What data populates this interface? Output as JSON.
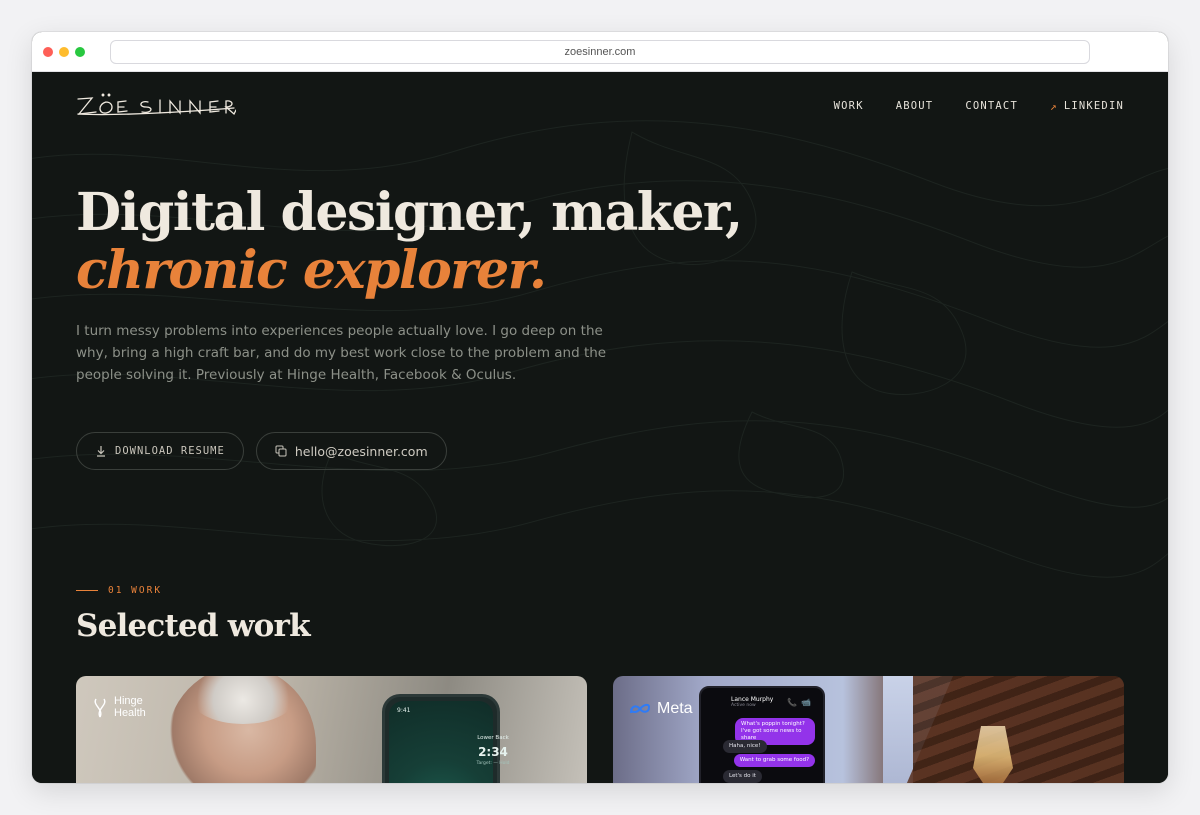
{
  "browser": {
    "url": "zoesinner.com"
  },
  "nav": {
    "logo_text": "ZOË SINNER",
    "links": [
      {
        "label": "WORK"
      },
      {
        "label": "ABOUT"
      },
      {
        "label": "CONTACT"
      },
      {
        "label": "LINKEDIN",
        "icon": "arrow-up-right-icon"
      }
    ]
  },
  "hero": {
    "title_line1": "Digital designer, maker,",
    "title_line2": "chronic explorer.",
    "copy": "I turn messy problems into experiences people actually love. I go deep on the why, bring a high craft bar, and do my best work close to the problem and the people solving it. Previously at Hinge Health, Facebook & Oculus.",
    "resume_label": "DOWNLOAD RESUME",
    "email_label": "hello@zoesinner.com"
  },
  "work": {
    "section_label": "01 WORK",
    "title": "Selected work",
    "cards": [
      {
        "brand": "Hinge Health",
        "brand_line1": "Hinge",
        "brand_line2": "Health",
        "phone_time": "9:41",
        "phone_caption": "Lower Back",
        "phone_timer": "2:34",
        "phone_sub": "Target: — Hold"
      },
      {
        "brand": "Meta",
        "contact_name": "Lance Murphy",
        "contact_status": "Active now",
        "messages": [
          {
            "dir": "out",
            "text": "What's poppin tonight? I've got some news to share"
          },
          {
            "dir": "in",
            "text": "Haha, nice!"
          },
          {
            "dir": "out",
            "text": "Want to grab some food?"
          },
          {
            "dir": "in",
            "text": "Let's do it"
          }
        ]
      }
    ]
  },
  "colors": {
    "background": "#121614",
    "accent": "#e8823a",
    "text_primary": "#efe9df",
    "text_muted": "#8c9088"
  }
}
